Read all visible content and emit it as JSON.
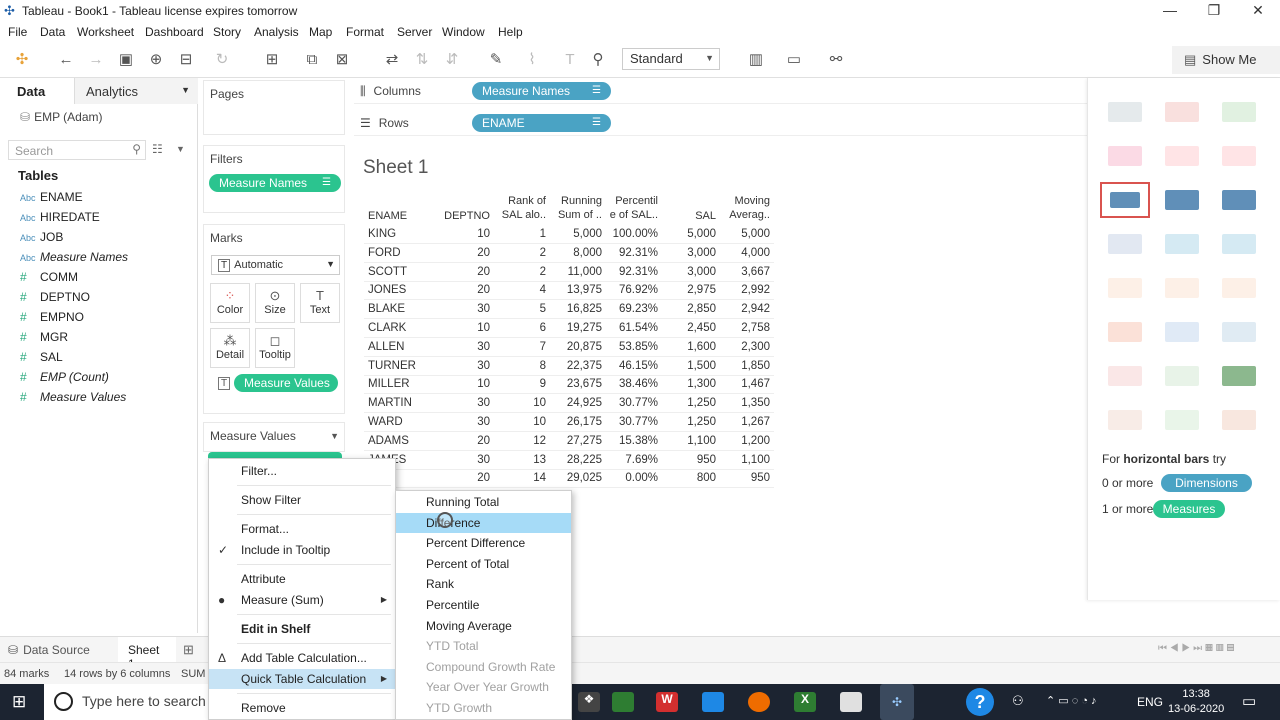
{
  "window": {
    "title": "Tableau - Book1 - Tableau license expires tomorrow"
  },
  "menubar": [
    "File",
    "Data",
    "Worksheet",
    "Dashboard",
    "Story",
    "Analysis",
    "Map",
    "Format",
    "Server",
    "Window",
    "Help"
  ],
  "toolbar": {
    "view_select": "Standard",
    "show_me": "Show Me"
  },
  "datapane": {
    "tab_data": "Data",
    "tab_analytics": "Analytics",
    "datasource": "EMP (Adam)",
    "search_placeholder": "Search",
    "tables_header": "Tables",
    "fields": [
      {
        "type": "Abc",
        "name": "ENAME"
      },
      {
        "type": "Abc",
        "name": "HIREDATE"
      },
      {
        "type": "Abc",
        "name": "JOB"
      },
      {
        "type": "Abc",
        "name": "Measure Names"
      },
      {
        "type": "#",
        "name": "COMM"
      },
      {
        "type": "#",
        "name": "DEPTNO"
      },
      {
        "type": "#",
        "name": "EMPNO"
      },
      {
        "type": "#",
        "name": "MGR"
      },
      {
        "type": "#",
        "name": "SAL"
      },
      {
        "type": "#",
        "name": "EMP (Count)"
      },
      {
        "type": "#",
        "name": "Measure Values"
      }
    ]
  },
  "shelves": {
    "pages": "Pages",
    "filters": "Filters",
    "filter_pill": "Measure Names",
    "marks": "Marks",
    "marks_type": "Automatic",
    "mark_buttons": [
      "Color",
      "Size",
      "Text",
      "Detail",
      "Tooltip"
    ],
    "marks_pill": "Measure Values",
    "measure_values": "Measure Values",
    "columns_label": "Columns",
    "columns_pill": "Measure Names",
    "rows_label": "Rows",
    "rows_pill": "ENAME"
  },
  "sheet": {
    "title": "Sheet 1",
    "headers": [
      "ENAME",
      "DEPTNO",
      "Rank of\nSAL alo..",
      "Running\nSum of ..",
      "Percentil\ne of SAL..",
      "SAL",
      "Moving\nAverag.."
    ],
    "rows": [
      [
        "KING",
        "10",
        "1",
        "5,000",
        "100.00%",
        "5,000",
        "5,000"
      ],
      [
        "FORD",
        "20",
        "2",
        "8,000",
        "92.31%",
        "3,000",
        "4,000"
      ],
      [
        "SCOTT",
        "20",
        "2",
        "11,000",
        "92.31%",
        "3,000",
        "3,667"
      ],
      [
        "JONES",
        "20",
        "4",
        "13,975",
        "76.92%",
        "2,975",
        "2,992"
      ],
      [
        "BLAKE",
        "30",
        "5",
        "16,825",
        "69.23%",
        "2,850",
        "2,942"
      ],
      [
        "CLARK",
        "10",
        "6",
        "19,275",
        "61.54%",
        "2,450",
        "2,758"
      ],
      [
        "ALLEN",
        "30",
        "7",
        "20,875",
        "53.85%",
        "1,600",
        "2,300"
      ],
      [
        "TURNER",
        "30",
        "8",
        "22,375",
        "46.15%",
        "1,500",
        "1,850"
      ],
      [
        "MILLER",
        "10",
        "9",
        "23,675",
        "38.46%",
        "1,300",
        "1,467"
      ],
      [
        "MARTIN",
        "30",
        "10",
        "24,925",
        "30.77%",
        "1,250",
        "1,350"
      ],
      [
        "WARD",
        "30",
        "10",
        "26,175",
        "30.77%",
        "1,250",
        "1,267"
      ],
      [
        "ADAMS",
        "20",
        "12",
        "27,275",
        "15.38%",
        "1,100",
        "1,200"
      ],
      [
        "JAMES",
        "30",
        "13",
        "28,225",
        "7.69%",
        "950",
        "1,100"
      ],
      [
        "",
        "20",
        "14",
        "29,025",
        "0.00%",
        "800",
        "950"
      ]
    ]
  },
  "showme": {
    "hint_prefix": "For ",
    "hint_bold": "horizontal bars",
    "hint_suffix": " try",
    "dims_count": "0 or more",
    "dims_pill": "Dimensions",
    "meas_count": "1 or more",
    "meas_pill": "Measures"
  },
  "bottom": {
    "datasource_tab": "Data Source",
    "sheet_tab": "Sheet 1"
  },
  "status": {
    "marks": "84 marks",
    "rows_cols": "14 rows by 6 columns",
    "sum": "SUM"
  },
  "context_menu": [
    {
      "label": "Filter...",
      "check": ""
    },
    {
      "label": "Show Filter",
      "check": ""
    },
    {
      "label": "Format...",
      "check": ""
    },
    {
      "label": "Include in Tooltip",
      "check": "✓"
    },
    {
      "label": "Attribute",
      "check": ""
    },
    {
      "label": "Measure (Sum)",
      "check": "●",
      "submenu": true
    },
    {
      "label": "Edit in Shelf",
      "check": "",
      "bold": true
    },
    {
      "label": "Add Table Calculation...",
      "check": "Δ"
    },
    {
      "label": "Quick Table Calculation",
      "check": "",
      "submenu": true,
      "highlight": true
    },
    {
      "label": "Remove",
      "check": ""
    }
  ],
  "quick_calc_menu": [
    {
      "label": "Running Total",
      "enabled": true
    },
    {
      "label": "Difference",
      "enabled": true,
      "highlight": true
    },
    {
      "label": "Percent Difference",
      "enabled": true
    },
    {
      "label": "Percent of Total",
      "enabled": true
    },
    {
      "label": "Rank",
      "enabled": true
    },
    {
      "label": "Percentile",
      "enabled": true
    },
    {
      "label": "Moving Average",
      "enabled": true
    },
    {
      "label": "YTD Total",
      "enabled": false
    },
    {
      "label": "Compound Growth Rate",
      "enabled": false
    },
    {
      "label": "Year Over Year Growth",
      "enabled": false
    },
    {
      "label": "YTD Growth",
      "enabled": false
    }
  ],
  "taskbar": {
    "search_placeholder": "Type here to search",
    "lang": "ENG",
    "time": "13:38",
    "date": "13-06-2020"
  },
  "colors": {
    "dim_pill": "#4aa3c4",
    "meas_pill": "#2bc48f",
    "menu_highlight": "#a6dbf7",
    "taskbar": "#1c2431"
  }
}
